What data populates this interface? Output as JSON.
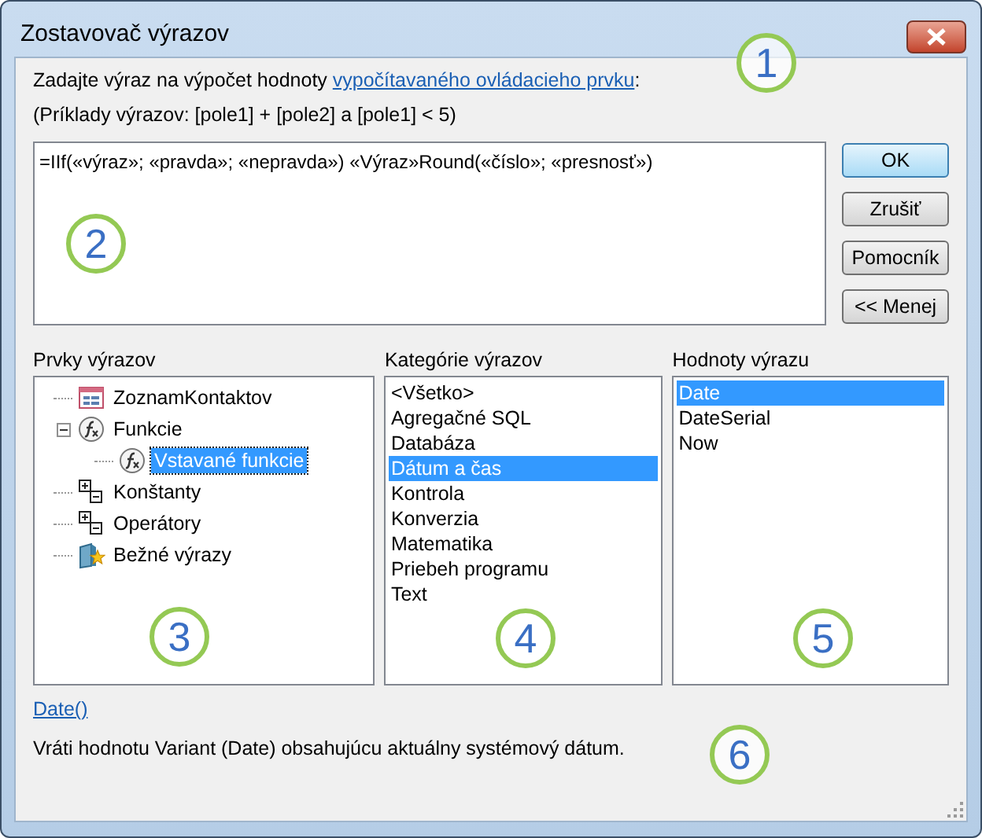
{
  "window": {
    "title": "Zostavovač výrazov"
  },
  "prompt": {
    "text": "Zadajte výraz na výpočet hodnoty",
    "link": "vypočítavaného ovládacieho prvku",
    "after": ":"
  },
  "example": "(Príklady výrazov: [pole1] + [pole2] a [pole1] < 5)",
  "expression": {
    "value": "=IIf(«výraz»; «pravda»; «nepravda») «Výraz»Round(«číslo»; «presnosť»)"
  },
  "buttons": [
    {
      "label": "OK",
      "default": true
    },
    {
      "label": "Zrušiť",
      "default": false
    },
    {
      "label": "Pomocník",
      "default": false
    },
    {
      "label": "<< Menej",
      "default": false
    }
  ],
  "elements": {
    "label": "Prvky výrazov",
    "items": [
      {
        "label": "ZoznamKontaktov",
        "kind": "form",
        "selected": false
      },
      {
        "label": "Funkcie",
        "kind": "function",
        "selected": false,
        "expanded": true,
        "children": [
          {
            "label": "Vstavané funkcie",
            "kind": "function",
            "selected": true
          }
        ]
      },
      {
        "label": "Konštanty",
        "kind": "operators",
        "selected": false
      },
      {
        "label": "Operátory",
        "kind": "operators",
        "selected": false
      },
      {
        "label": "Bežné výrazy",
        "kind": "common",
        "selected": false
      }
    ]
  },
  "categories": {
    "label": "Kategórie výrazov",
    "items": [
      {
        "label": "<Všetko>",
        "selected": false
      },
      {
        "label": "Agregačné SQL",
        "selected": false
      },
      {
        "label": "Databáza",
        "selected": false
      },
      {
        "label": "Dátum a čas",
        "selected": true
      },
      {
        "label": "Kontrola",
        "selected": false
      },
      {
        "label": "Konverzia",
        "selected": false
      },
      {
        "label": "Matematika",
        "selected": false
      },
      {
        "label": "Priebeh programu",
        "selected": false
      },
      {
        "label": "Text",
        "selected": false
      }
    ]
  },
  "values": {
    "label": "Hodnoty výrazu",
    "items": [
      {
        "label": "Date",
        "selected": true
      },
      {
        "label": "DateSerial",
        "selected": false
      },
      {
        "label": "Now",
        "selected": false
      }
    ]
  },
  "help": {
    "link": "Date()",
    "description": "Vráti hodnotu Variant (Date) obsahujúcu aktuálny systémový dátum."
  },
  "callouts": [
    "1",
    "2",
    "3",
    "4",
    "5",
    "6"
  ]
}
